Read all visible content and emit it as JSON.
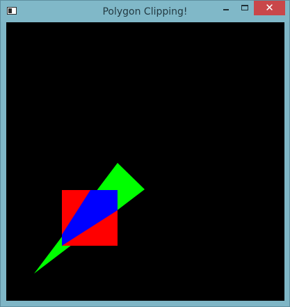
{
  "window": {
    "title": "Polygon Clipping!",
    "icons": {
      "app": "app-window-icon",
      "minimize": "minimize-icon",
      "maximize": "maximize-icon",
      "close": "close-icon"
    },
    "close_glyph": "✕",
    "colors": {
      "frame": "#80b8c8",
      "close_button": "#c9474a"
    }
  },
  "canvas": {
    "background": "#000000",
    "shapes": [
      {
        "name": "subject-triangle",
        "color": "#00ff00"
      },
      {
        "name": "clip-square",
        "color": "#ff0000"
      },
      {
        "name": "clipped-region",
        "color": "#0000ff"
      }
    ]
  }
}
